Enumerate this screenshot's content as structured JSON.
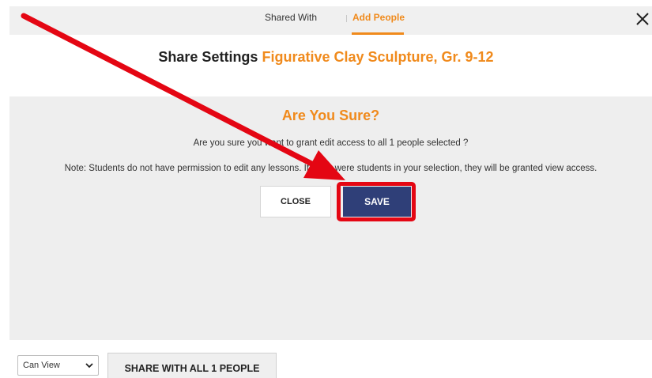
{
  "tabs": {
    "shared_with": "Shared With",
    "add_people": "Add People",
    "active": "add_people"
  },
  "header": {
    "title_prefix": "Share Settings",
    "lesson_name": "Figurative Clay Sculpture, Gr. 9-12"
  },
  "dialog": {
    "title": "Are You Sure?",
    "question": "Are you sure you want to grant edit access to all 1 people selected ?",
    "note": "Note: Students do not have permission to edit any lessons. If there were students in your selection, they will be granted view access.",
    "close_label": "CLOSE",
    "save_label": "SAVE"
  },
  "footer": {
    "permission_value": "Can View",
    "share_button_label": "SHARE WITH ALL 1 PEOPLE"
  },
  "colors": {
    "accent_orange": "#f08a1c",
    "save_blue": "#2f3f78",
    "highlight_red": "#e40613"
  },
  "icons": {
    "close": "close-icon",
    "dropdown": "chevron-down-icon",
    "annotation": "annotation-arrow"
  }
}
